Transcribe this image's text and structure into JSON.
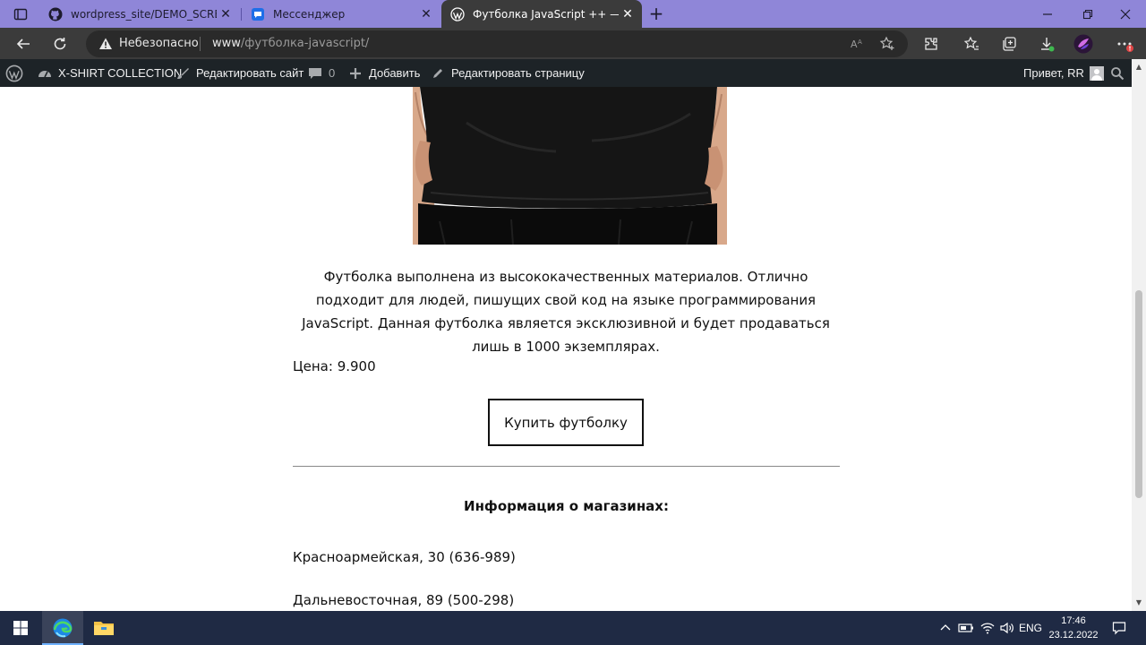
{
  "browser": {
    "tabs": [
      {
        "title": "wordpress_site/DEMO_SCREENS",
        "icon": "github-icon",
        "active": false
      },
      {
        "title": "Мессенджер",
        "icon": "messenger-icon",
        "active": false
      },
      {
        "title": "Футболка JavaScript ++ — X-SHIRT",
        "icon": "wordpress-icon",
        "active": true
      }
    ],
    "security_label": "Небезопасно",
    "url_host": "www",
    "url_path": "/футболка-javascript/"
  },
  "admin_bar": {
    "site_name": "X-SHIRT COLLECTION",
    "edit_site": "Редактировать сайт",
    "comments_count": "0",
    "add_new": "Добавить",
    "edit_page": "Редактировать страницу",
    "greeting": "Привет, RR"
  },
  "product": {
    "description": "Футболка выполнена из высококачественных материалов. Отлично подходит для людей, пишущих свой код на языке программирования JavaScript. Данная футболка является эксклюзивной и будет продаваться лишь в 1000 экземплярах.",
    "price_label": "Цена: 9.900",
    "buy_button": "Купить футболку"
  },
  "shops": {
    "title": "Информация о магазинах:",
    "items": [
      "Красноармейская, 30 (636-989)",
      "Дальневосточная, 89 (500-298)"
    ]
  },
  "taskbar": {
    "language": "ENG",
    "time": "17:46",
    "date": "23.12.2022"
  }
}
